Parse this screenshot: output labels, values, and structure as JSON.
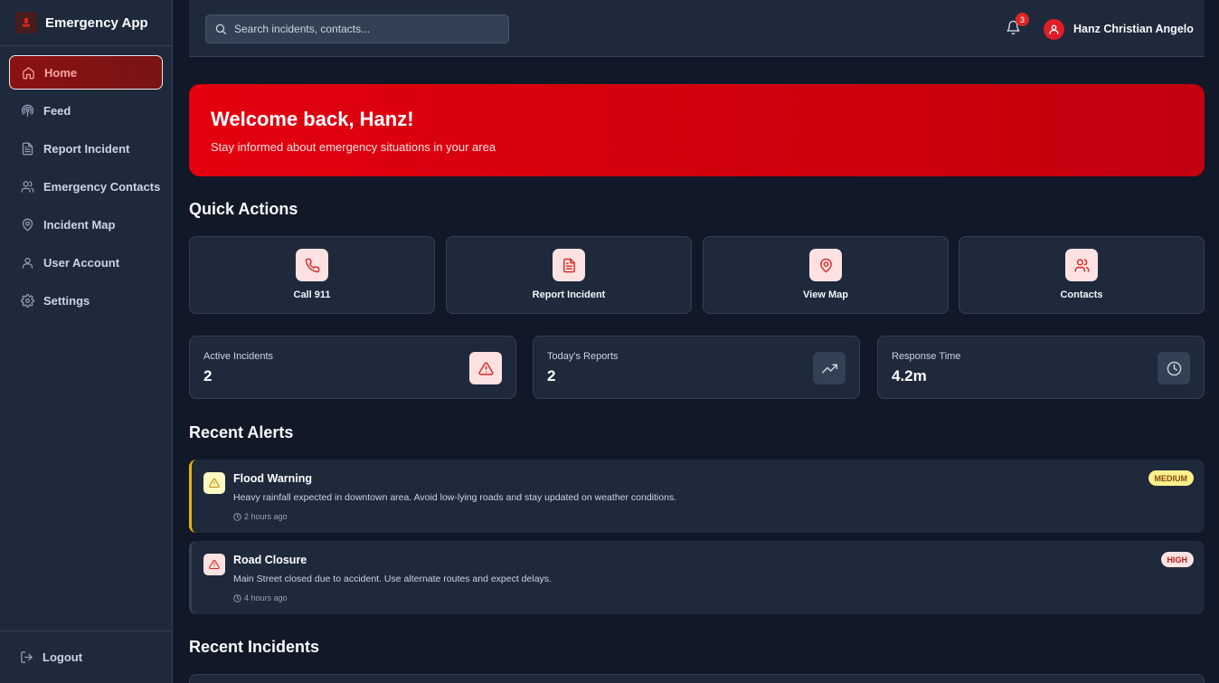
{
  "app": {
    "title": "Emergency App"
  },
  "sidebar": {
    "items": [
      {
        "label": "Home",
        "icon": "home-icon",
        "active": true
      },
      {
        "label": "Feed",
        "icon": "feed-icon"
      },
      {
        "label": "Report Incident",
        "icon": "document-icon"
      },
      {
        "label": "Emergency Contacts",
        "icon": "users-icon"
      },
      {
        "label": "Incident Map",
        "icon": "map-pin-icon"
      },
      {
        "label": "User Account",
        "icon": "user-icon"
      },
      {
        "label": "Settings",
        "icon": "gear-icon"
      }
    ],
    "logout_label": "Logout"
  },
  "header": {
    "search_placeholder": "Search incidents, contacts...",
    "notification_count": "3",
    "user_name": "Hanz Christian Angelo"
  },
  "welcome": {
    "title": "Welcome back, Hanz!",
    "subtitle": "Stay informed about emergency situations in your area"
  },
  "quick_actions": {
    "title": "Quick Actions",
    "items": [
      {
        "label": "Call 911",
        "icon": "phone-icon"
      },
      {
        "label": "Report Incident",
        "icon": "document-icon"
      },
      {
        "label": "View Map",
        "icon": "map-pin-icon"
      },
      {
        "label": "Contacts",
        "icon": "users-icon"
      }
    ]
  },
  "stats": [
    {
      "label": "Active Incidents",
      "value": "2",
      "icon": "alert-triangle-icon"
    },
    {
      "label": "Today's Reports",
      "value": "2",
      "icon": "trending-up-icon"
    },
    {
      "label": "Response Time",
      "value": "4.2m",
      "icon": "clock-icon"
    }
  ],
  "recent_alerts": {
    "title": "Recent Alerts",
    "items": [
      {
        "title": "Flood Warning",
        "description": "Heavy rainfall expected in downtown area. Avoid low-lying roads and stay updated on weather conditions.",
        "time": "2 hours ago",
        "severity": "MEDIUM",
        "severity_color": "#eab308"
      },
      {
        "title": "Road Closure",
        "description": "Main Street closed due to accident. Use alternate routes and expect delays.",
        "time": "4 hours ago",
        "severity": "HIGH",
        "severity_color": "#dc2626"
      }
    ]
  },
  "recent_incidents": {
    "title": "Recent Incidents"
  },
  "colors": {
    "accent": "#e3000f",
    "background": "#111827",
    "surface": "#1e293b"
  }
}
